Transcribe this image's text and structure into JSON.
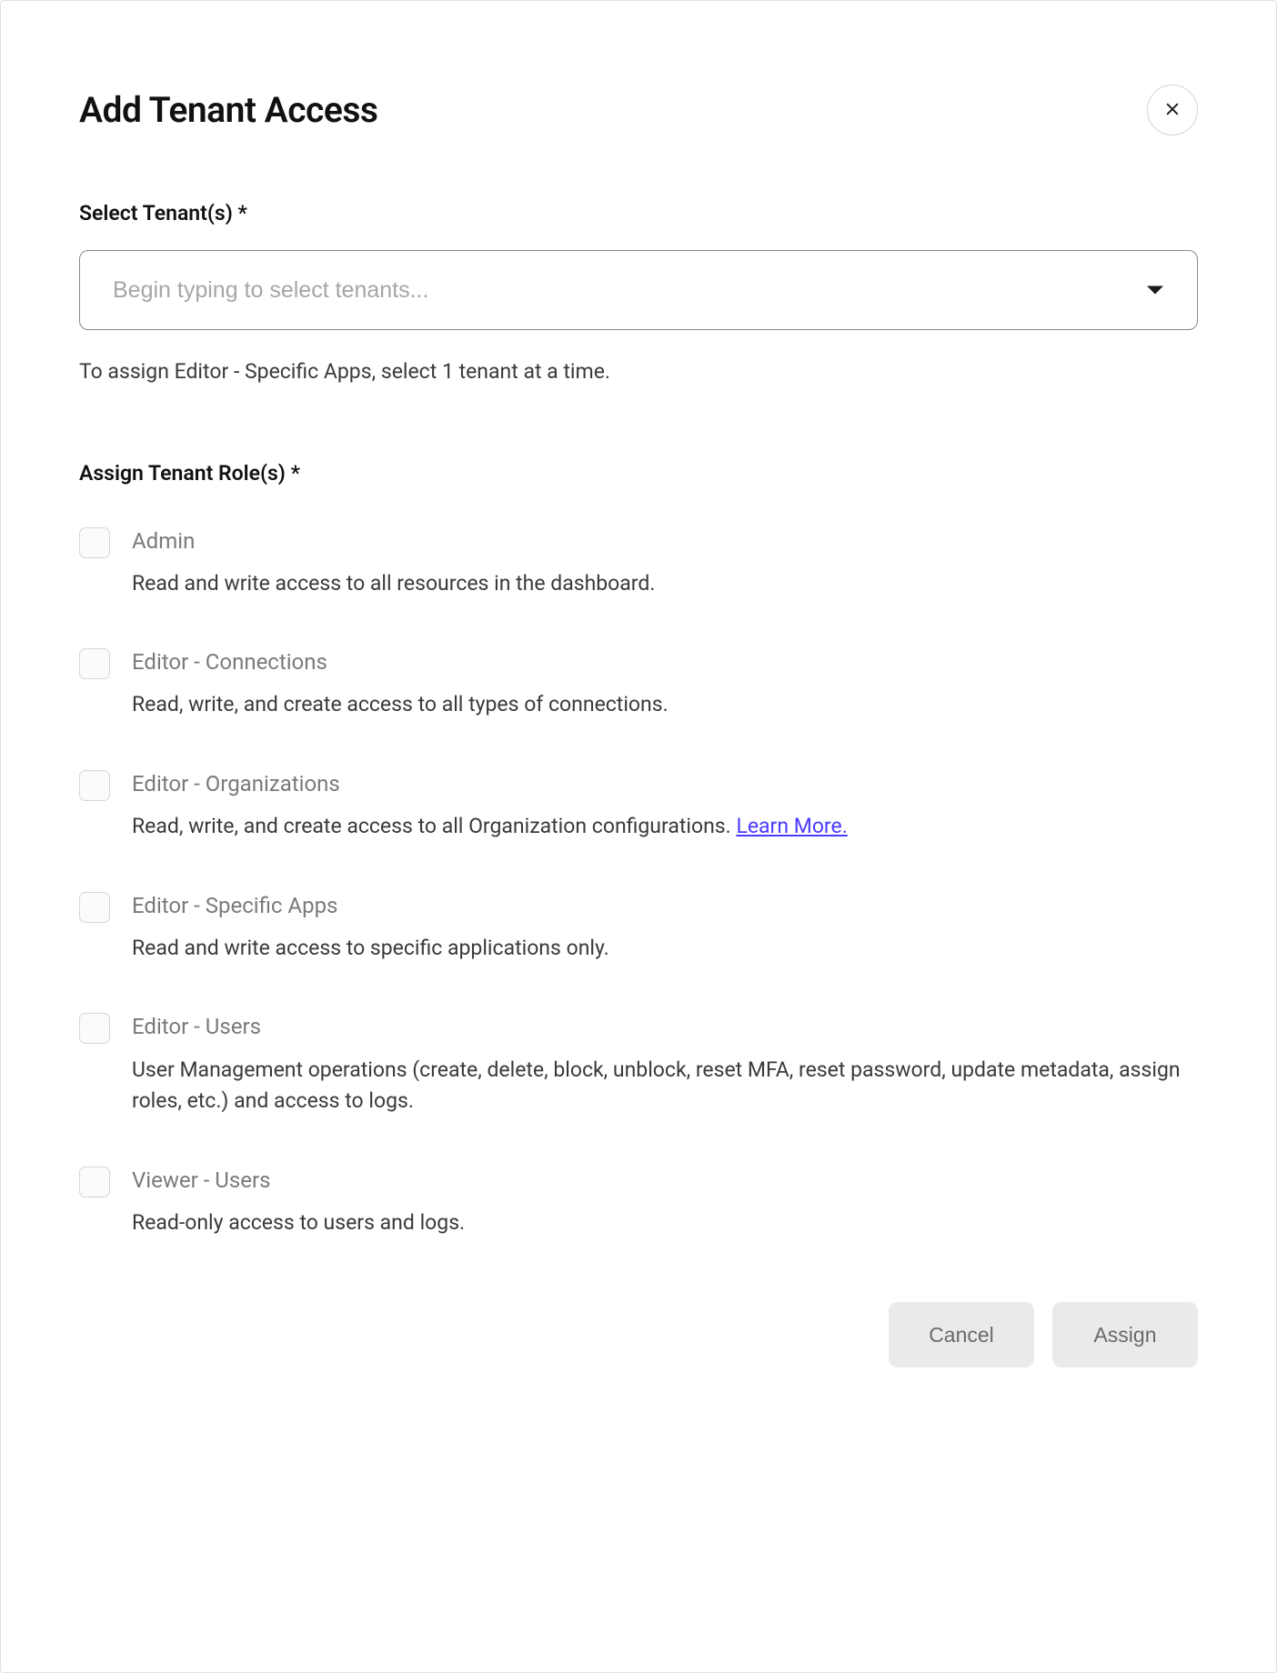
{
  "modal": {
    "title": "Add Tenant Access",
    "close_label": "Close"
  },
  "tenant_field": {
    "label": "Select Tenant(s) *",
    "placeholder": "Begin typing to select tenants...",
    "helper": "To assign Editor - Specific Apps, select 1 tenant at a time."
  },
  "roles_field": {
    "label": "Assign Tenant Role(s) *",
    "learn_more": "Learn More.",
    "items": [
      {
        "name": "Admin",
        "desc": "Read and write access to all resources in the dashboard.",
        "has_learn_more": false
      },
      {
        "name": "Editor - Connections",
        "desc": "Read, write, and create access to all types of connections.",
        "has_learn_more": false
      },
      {
        "name": "Editor - Organizations",
        "desc": "Read, write, and create access to all Organization configurations.",
        "has_learn_more": true
      },
      {
        "name": "Editor - Specific Apps",
        "desc": "Read and write access to specific applications only.",
        "has_learn_more": false
      },
      {
        "name": "Editor - Users",
        "desc": "User Management operations (create, delete, block, unblock, reset MFA, reset password, update metadata, assign roles, etc.) and access to logs.",
        "has_learn_more": false
      },
      {
        "name": "Viewer - Users",
        "desc": "Read-only access to users and logs.",
        "has_learn_more": false
      }
    ]
  },
  "footer": {
    "cancel": "Cancel",
    "assign": "Assign"
  }
}
